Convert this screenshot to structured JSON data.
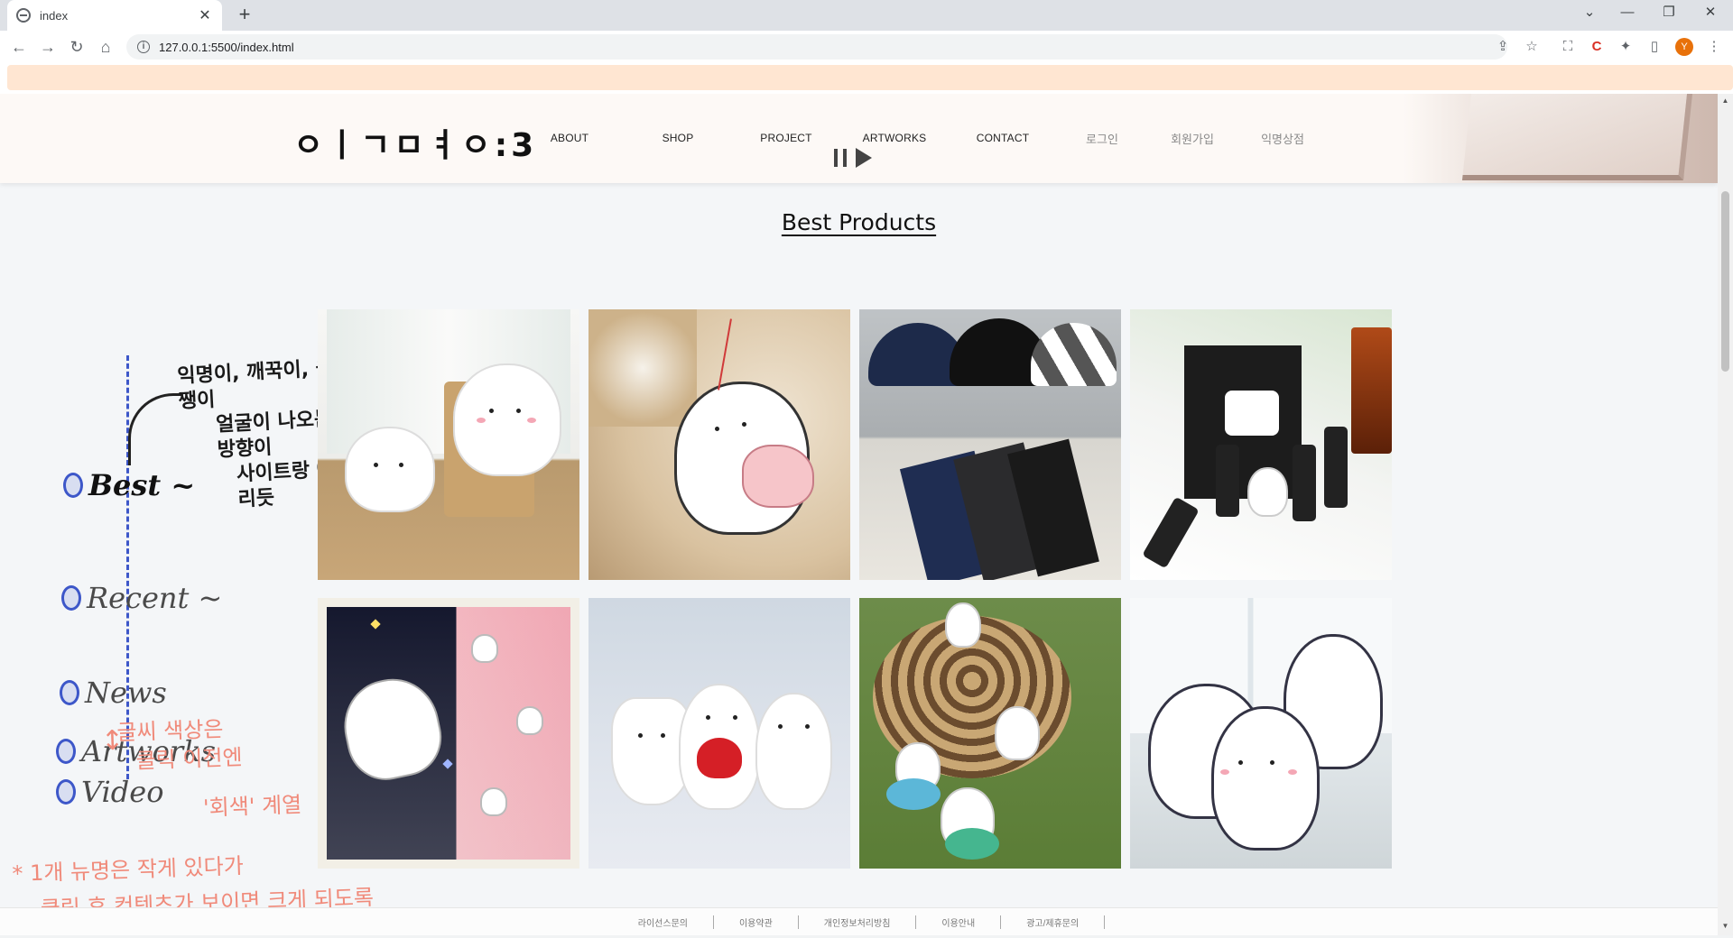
{
  "browser": {
    "tab_title": "index",
    "tab_close": "✕",
    "new_tab": "+",
    "url": "127.0.0.1:5500/index.html",
    "window_controls": {
      "minimize": "—",
      "restore": "❐",
      "close": "✕",
      "tabsearch": "⌄"
    },
    "profile_initial": "Y"
  },
  "site": {
    "logo": "ㅇㅣㄱㅁㅕㅇ:3",
    "nav": [
      "ABOUT",
      "SHOP",
      "PROJECT",
      "ARTWORKS",
      "CONTACT"
    ],
    "nav_ko": [
      "로그인",
      "회원가입",
      "익명상점"
    ]
  },
  "section": {
    "title": "Best Products"
  },
  "products": [
    {
      "name": "plush-pair"
    },
    {
      "name": "air-freshener"
    },
    {
      "name": "umbrellas"
    },
    {
      "name": "coffee-set"
    },
    {
      "name": "blanket"
    },
    {
      "name": "figures-heart"
    },
    {
      "name": "hat-figures"
    },
    {
      "name": "cushions"
    }
  ],
  "sidebar": {
    "note_top": [
      "익명이, 깨꾹이, 올쨍이",
      "얼굴이 나오는 방향이",
      "사이트랑 어울리듯"
    ],
    "items": [
      "Best ~",
      "Recent ~",
      "News",
      "Video",
      "Artworks"
    ],
    "note_color": [
      "글씨 색상은",
      "클릭 이전엔",
      "'회색' 계열"
    ],
    "note_bottom": [
      "* 1개 뉴명은 작게 있다가",
      "클릭 후 컨텐츠가 보이면 크게 되도록"
    ]
  },
  "footer": {
    "links": [
      "라이선스문의",
      "이용약관",
      "개인정보처리방침",
      "이용안내",
      "광고/제휴문의"
    ]
  },
  "colors": {
    "accent_blue": "#3d57c9",
    "note_pink": "#f08a7a",
    "infobar": "#ffe6d2"
  }
}
